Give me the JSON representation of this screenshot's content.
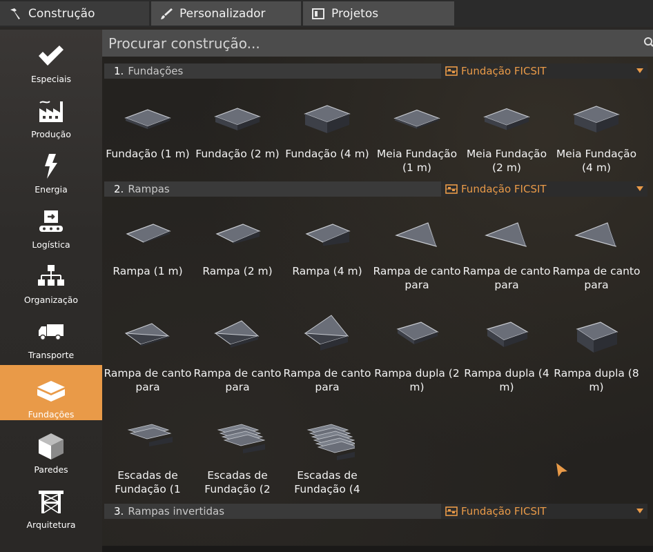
{
  "tabs": [
    {
      "label": "Construção",
      "icon": "hammer-icon"
    },
    {
      "label": "Personalizador",
      "icon": "brush-icon"
    },
    {
      "label": "Projetos",
      "icon": "blueprint-icon"
    }
  ],
  "sidebar": {
    "items": [
      {
        "label": "Especiais",
        "icon": "checkmark-icon"
      },
      {
        "label": "Produção",
        "icon": "factory-icon"
      },
      {
        "label": "Energia",
        "icon": "lightning-icon"
      },
      {
        "label": "Logística",
        "icon": "conveyor-icon"
      },
      {
        "label": "Organização",
        "icon": "hierarchy-icon"
      },
      {
        "label": "Transporte",
        "icon": "truck-icon"
      },
      {
        "label": "Fundações",
        "icon": "foundation-icon",
        "active": true
      },
      {
        "label": "Paredes",
        "icon": "wall-cube-icon"
      },
      {
        "label": "Arquitetura",
        "icon": "scaffold-icon"
      }
    ],
    "active_color": "#e99a48"
  },
  "search": {
    "placeholder": "Procurar construção..."
  },
  "sections": [
    {
      "number": "1.",
      "title": "Fundações",
      "filter": "Fundação FICSIT",
      "items": [
        "Fundação (1 m)",
        "Fundação (2 m)",
        "Fundação (4 m)",
        "Meia Fundação (1 m)",
        "Meia Fundação (2 m)",
        "Meia Fundação (4 m)"
      ]
    },
    {
      "number": "2.",
      "title": "Rampas",
      "filter": "Fundação FICSIT",
      "items": [
        "Rampa (1 m)",
        "Rampa (2 m)",
        "Rampa (4 m)",
        "Rampa de canto para",
        "Rampa de canto para",
        "Rampa de canto para",
        "Rampa de canto para",
        "Rampa de canto para",
        "Rampa de canto para",
        "Rampa dupla (2 m)",
        "Rampa dupla (4 m)",
        "Rampa dupla (8 m)",
        "Escadas de Fundação (1",
        "Escadas de Fundação (2",
        "Escadas de Fundação (4"
      ]
    },
    {
      "number": "3.",
      "title": "Rampas invertidas",
      "filter": "Fundação FICSIT"
    }
  ],
  "colors": {
    "accent": "#e99a48",
    "panel": "#3a3a3a",
    "search_bg": "#4c4c4c"
  }
}
